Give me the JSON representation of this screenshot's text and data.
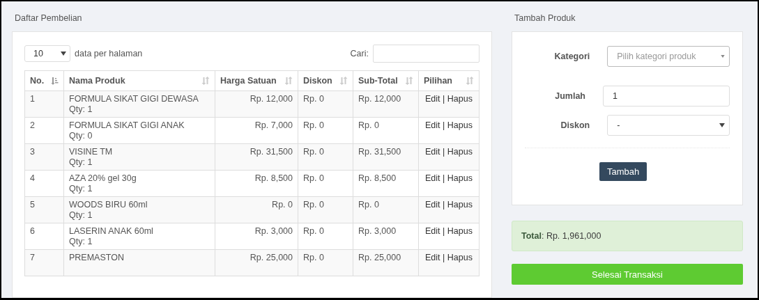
{
  "purchase_list": {
    "title": "Daftar Pembelian",
    "page_size": {
      "value": "10",
      "label": "data per halaman"
    },
    "search": {
      "label": "Cari:"
    },
    "columns": [
      {
        "label": "No.",
        "sorted": true
      },
      {
        "label": "Nama Produk",
        "sorted": false
      },
      {
        "label": "Harga Satuan",
        "sorted": false
      },
      {
        "label": "Diskon",
        "sorted": false
      },
      {
        "label": "Sub-Total",
        "sorted": false
      },
      {
        "label": "Pilihan",
        "sorted": false
      }
    ],
    "rows": [
      {
        "no": "1",
        "name": "FORMULA SIKAT GIGI DEWASA",
        "qty": "Qty: 1",
        "price": "Rp. 12,000",
        "discount": "Rp. 0",
        "subtotal": "Rp. 12,000",
        "edit": "Edit",
        "separator": "|",
        "delete": "Hapus"
      },
      {
        "no": "2",
        "name": "FORMULA SIKAT GIGI ANAK",
        "qty": "Qty: 0",
        "price": "Rp. 7,000",
        "discount": "Rp. 0",
        "subtotal": "Rp. 0",
        "edit": "Edit",
        "separator": "|",
        "delete": "Hapus"
      },
      {
        "no": "3",
        "name": "VISINE TM",
        "qty": "Qty: 1",
        "price": "Rp. 31,500",
        "discount": "Rp. 0",
        "subtotal": "Rp. 31,500",
        "edit": "Edit",
        "separator": "|",
        "delete": "Hapus"
      },
      {
        "no": "4",
        "name": "AZA 20% gel 30g",
        "qty": "Qty: 1",
        "price": "Rp. 8,500",
        "discount": "Rp. 0",
        "subtotal": "Rp. 8,500",
        "edit": "Edit",
        "separator": "|",
        "delete": "Hapus"
      },
      {
        "no": "5",
        "name": "WOODS BIRU 60ml",
        "qty": "Qty: 1",
        "price": "Rp. 0",
        "discount": "Rp. 0",
        "subtotal": "Rp. 0",
        "edit": "Edit",
        "separator": "|",
        "delete": "Hapus"
      },
      {
        "no": "6",
        "name": "LASERIN ANAK 60ml",
        "qty": "Qty: 1",
        "price": "Rp. 3,000",
        "discount": "Rp. 0",
        "subtotal": "Rp. 3,000",
        "edit": "Edit",
        "separator": "|",
        "delete": "Hapus"
      },
      {
        "no": "7",
        "name": "PREMASTON",
        "price": "Rp. 25,000",
        "discount": "Rp. 0",
        "subtotal": "Rp. 25,000",
        "edit": "Edit",
        "separator": "|",
        "delete": "Hapus"
      }
    ]
  },
  "add_product": {
    "title": "Tambah Produk",
    "category": {
      "label": "Kategori",
      "placeholder": "Pilih kategori produk"
    },
    "quantity": {
      "label": "Jumlah",
      "value": "1"
    },
    "discount": {
      "label": "Diskon",
      "value": "-"
    },
    "button": "Tambah"
  },
  "total": {
    "label": "Total",
    "separator": ":",
    "value": "Rp. 1,961,000"
  },
  "finish_button": "Selesai Transaksi"
}
